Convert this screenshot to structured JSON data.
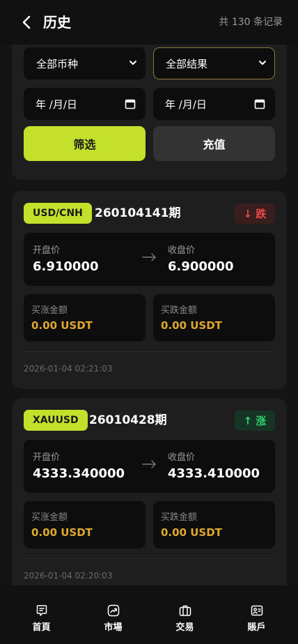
{
  "header": {
    "title": "历史",
    "record_count": "共 130 条记录"
  },
  "filters": {
    "currency_select": "全部币种",
    "result_select": "全部结果",
    "start_date": "年 /月/日",
    "end_date": "年 /月/日",
    "filter_button": "筛选",
    "recharge_button": "充值"
  },
  "records": [
    {
      "symbol": "USD/CNH",
      "period": "260104141期",
      "direction": "↓ 跌",
      "open_label": "开盘价",
      "open_price": "6.910000",
      "close_label": "收盘价",
      "close_price": "6.900000",
      "buy_up_label": "买涨金额",
      "buy_up_amount": "0.00 USDT",
      "buy_down_label": "买跌金额",
      "buy_down_amount": "0.00 USDT",
      "time": "2026-01-04 02:21:03"
    },
    {
      "symbol": "XAUUSD",
      "period": "26010428期",
      "direction": "↑ 涨",
      "open_label": "开盘价",
      "open_price": "4333.340000",
      "close_label": "收盘价",
      "close_price": "4333.410000",
      "buy_up_label": "买涨金额",
      "buy_up_amount": "0.00 USDT",
      "buy_down_label": "买跌金额",
      "buy_down_amount": "0.00 USDT",
      "time": "2026-01-04 02:20:03"
    }
  ],
  "nav": {
    "items": [
      {
        "label": "首頁",
        "icon": "home-icon"
      },
      {
        "label": "市場",
        "icon": "market-icon"
      },
      {
        "label": "交易",
        "icon": "trade-icon"
      },
      {
        "label": "賬戶",
        "icon": "account-icon"
      }
    ]
  },
  "colors": {
    "accent": "#c4e02b",
    "down": "#e84a4a",
    "up": "#2fcf6f",
    "amount": "#e0a82e"
  }
}
